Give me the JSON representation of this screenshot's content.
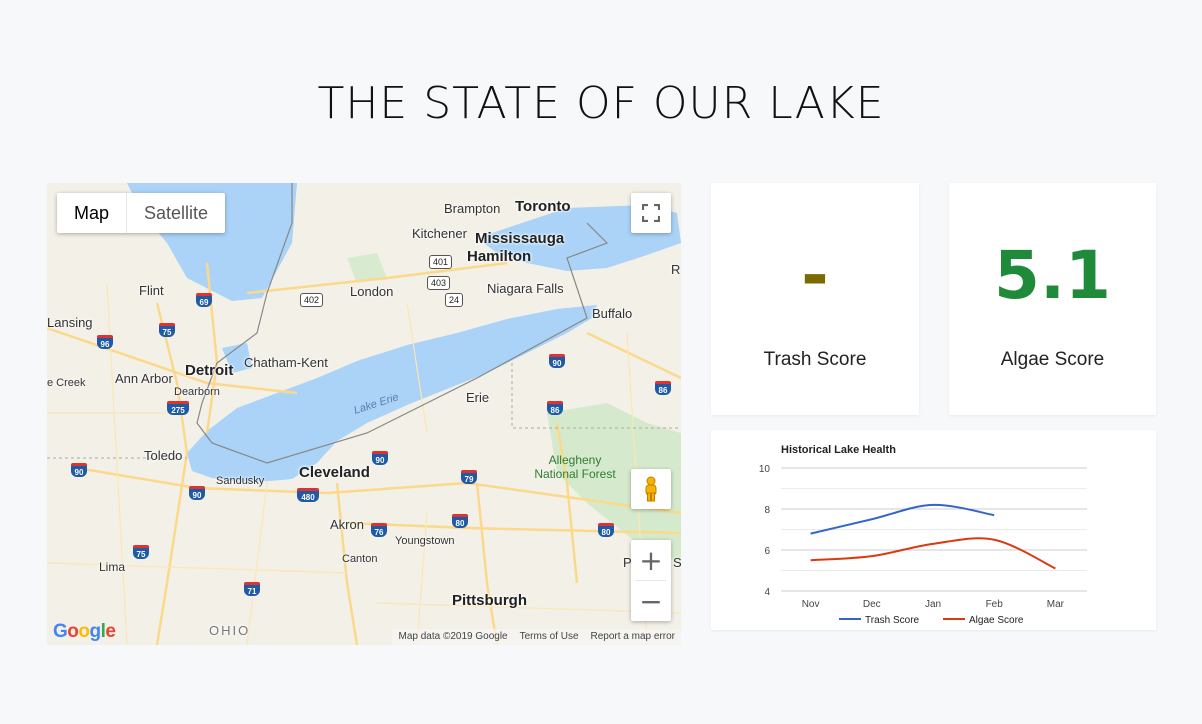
{
  "page": {
    "title": "THE STATE OF OUR LAKE"
  },
  "map": {
    "type_controls": {
      "map_label": "Map",
      "satellite_label": "Satellite",
      "active": "Map"
    },
    "cities_major": [
      "Toronto",
      "Mississauga",
      "Hamilton",
      "Detroit",
      "Cleveland",
      "Pittsburgh"
    ],
    "cities_minor": [
      "Brampton",
      "Kitchener",
      "Niagara Falls",
      "Buffalo",
      "London",
      "Flint",
      "Lansing",
      "Chatham-Kent",
      "Ann Arbor",
      "Dearborn",
      "Toledo",
      "Erie",
      "Sandusky",
      "Akron",
      "Youngstown",
      "Canton",
      "Lima"
    ],
    "edge_labels": [
      "e Creek",
      "R",
      "P",
      "S"
    ],
    "water_label": "Lake Erie",
    "park_label": "Allegheny National Forest",
    "state_label": "OHIO",
    "interstates": [
      "69",
      "75",
      "96",
      "275",
      "90",
      "86",
      "80",
      "79",
      "76",
      "480",
      "71"
    ],
    "highways": [
      "401",
      "402",
      "403",
      "24"
    ],
    "logo": "Google",
    "attribution": {
      "data": "Map data ©2019 Google",
      "terms": "Terms of Use",
      "report": "Report a map error"
    },
    "icons": {
      "fullscreen": "fullscreen-icon",
      "pegman": "pegman-icon",
      "zoom_in": "+",
      "zoom_out": "−"
    }
  },
  "scores": {
    "trash": {
      "value": "-",
      "label": "Trash Score",
      "color": "#7a6a00"
    },
    "algae": {
      "value": "5.1",
      "label": "Algae Score",
      "color": "#1e8a3a"
    }
  },
  "chart_data": {
    "type": "line",
    "title": "Historical Lake Health",
    "categories": [
      "Nov",
      "Dec",
      "Jan",
      "Feb",
      "Mar"
    ],
    "ylim": [
      4,
      10
    ],
    "yticks": [
      4,
      6,
      8,
      10
    ],
    "grid": true,
    "legend": "bottom",
    "series": [
      {
        "name": "Trash Score",
        "color": "#3366cc",
        "values": [
          6.8,
          7.5,
          8.2,
          7.7,
          null
        ]
      },
      {
        "name": "Algae Score",
        "color": "#dc3912",
        "values": [
          5.5,
          5.7,
          6.3,
          6.5,
          5.1
        ]
      }
    ]
  }
}
